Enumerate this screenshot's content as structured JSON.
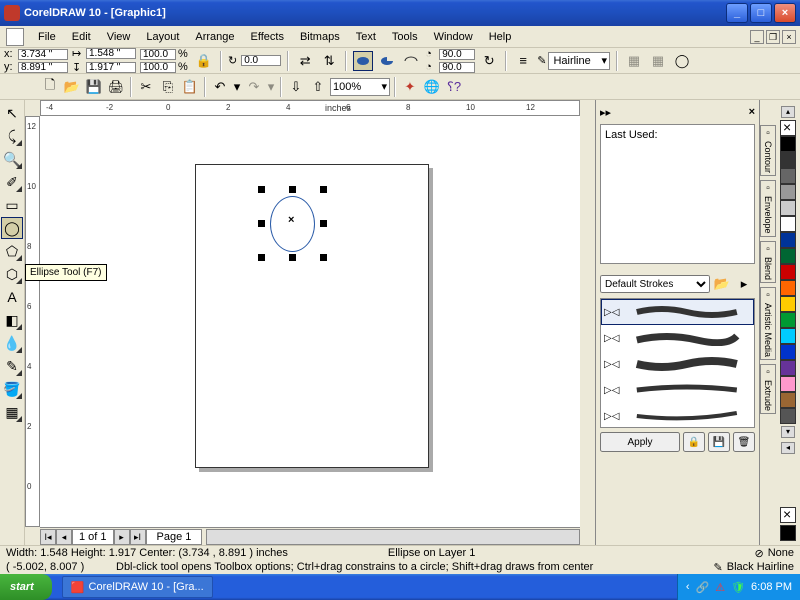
{
  "title": "CorelDRAW 10 - [Graphic1]",
  "menu": {
    "file": "File",
    "edit": "Edit",
    "view": "View",
    "layout": "Layout",
    "arrange": "Arrange",
    "effects": "Effects",
    "bitmaps": "Bitmaps",
    "text": "Text",
    "tools": "Tools",
    "window": "Window",
    "help": "Help"
  },
  "prop": {
    "x": "3.734 \"",
    "y": "8.891 \"",
    "w": "1.548 \"",
    "h": "1.917 \"",
    "sx": "100.0",
    "sy": "100.0",
    "rot": "0.0",
    "ang1": "90.0",
    "ang2": "90.0",
    "outline": "Hairline"
  },
  "std": {
    "zoom": "100%"
  },
  "ruler": {
    "units": "inches",
    "h": [
      "-4",
      "-2",
      "0",
      "2",
      "4",
      "6",
      "8",
      "10",
      "12"
    ],
    "v": [
      "12",
      "10",
      "8",
      "6",
      "4",
      "2",
      "0"
    ]
  },
  "tooltip": "Ellipse Tool (F7)",
  "pagenav": {
    "info": "1 of 1",
    "tab": "Page 1"
  },
  "docker": {
    "lastused": "Last Used:",
    "combo": "Default Strokes",
    "apply": "Apply"
  },
  "dtabs": [
    "Contour",
    "Envelope",
    "Blend",
    "Artistic Media",
    "Extrude"
  ],
  "palette": [
    "#000000",
    "#333333",
    "#666666",
    "#999999",
    "#cccccc",
    "#ffffff",
    "#003399",
    "#006633",
    "#cc0000",
    "#ff6600",
    "#ffcc00",
    "#009933",
    "#00ccff",
    "#0033cc",
    "#663399",
    "#ff99cc",
    "#996633",
    "#555555"
  ],
  "status1": {
    "dims": "Width: 1.548  Height: 1.917  Center: (3.734 , 8.891 )  inches",
    "obj": "Ellipse on Layer 1",
    "fill": "None"
  },
  "status2": {
    "coords": "( -5.002, 8.007 )",
    "hint": "Dbl-click tool opens Toolbox options; Ctrl+drag constrains to a circle; Shift+drag draws from center",
    "outline": "Black  Hairline"
  },
  "taskbar": {
    "start": "start",
    "task": "CorelDRAW 10 - [Gra...",
    "time": "6:08 PM"
  }
}
